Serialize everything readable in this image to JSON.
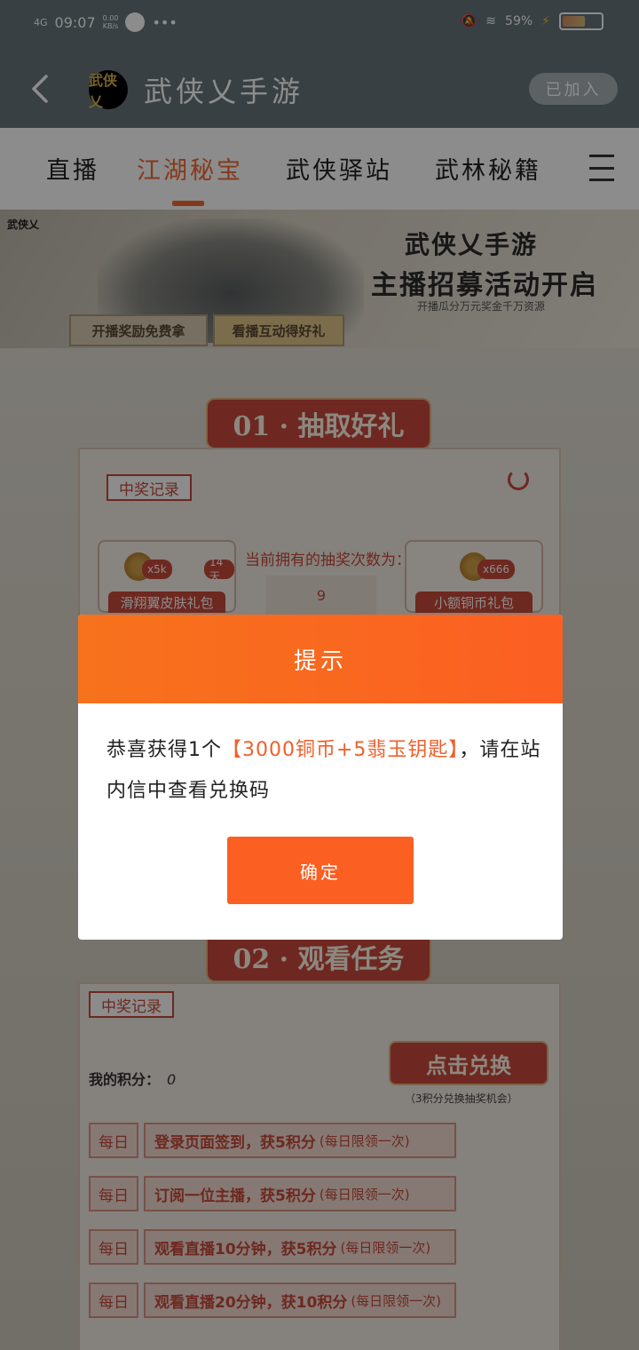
{
  "status_bar": {
    "network": "4G",
    "time": "09:07",
    "speed": "0.00",
    "speed_unit": "KB/s",
    "dots": "•••",
    "battery_level": 0.59,
    "battery_text": "59"
  },
  "header": {
    "logo_text": "武侠乂",
    "title": "武侠乂手游",
    "join_label": "已加入"
  },
  "tabs": [
    {
      "label": "直播",
      "active": false
    },
    {
      "label": "江湖秘宝",
      "active": true
    },
    {
      "label": "武侠驿站",
      "active": false
    },
    {
      "label": "武林秘籍",
      "active": false
    }
  ],
  "banner": {
    "logo": "武侠乂",
    "title_line1": "武侠乂手游",
    "title_line2": "主播招募活动开启",
    "subtitle": "开播瓜分万元奖金千万资源",
    "btn1": "开播奖励免费拿",
    "btn2": "看播互动得好礼"
  },
  "section1": {
    "title": "01 · 抽取好礼",
    "record_label": "中奖记录",
    "prize1": {
      "tag_a": "x5k",
      "tag_b": "14天",
      "name": "滑翔翼皮肤礼包"
    },
    "prize2": {
      "tag_a": "x666",
      "name": "小额铜币礼包"
    },
    "draw_label": "当前拥有的抽奖次数为：",
    "draw_count": "9"
  },
  "section2": {
    "title": "02 · 观看任务",
    "record_label": "中奖记录",
    "points_label": "我的积分：",
    "points_value": "0",
    "redeem_label": "点击兑换",
    "redeem_hint": "（3积分兑换抽奖机会）",
    "tasks": [
      {
        "badge": "每日",
        "text": "登录页面签到，获5积分",
        "note": "(每日限领一次)"
      },
      {
        "badge": "每日",
        "text": "订阅一位主播，获5积分",
        "note": "(每日限领一次)"
      },
      {
        "badge": "每日",
        "text": "观看直播10分钟，获5积分",
        "note": "(每日限领一次)"
      },
      {
        "badge": "每日",
        "text": "观看直播20分钟，获10积分",
        "note": "(每日限领一次)"
      }
    ]
  },
  "dialog": {
    "title": "提示",
    "msg_prefix": "恭喜获得1个",
    "msg_highlight": "【3000铜币+5翡玉钥匙】",
    "msg_suffix": "，请在站内信中查看兑换码",
    "ok_label": "确定"
  },
  "colors": {
    "accent": "#f06a30",
    "dialog_header": "#fb5f22",
    "section_red": "#c94a3c"
  }
}
